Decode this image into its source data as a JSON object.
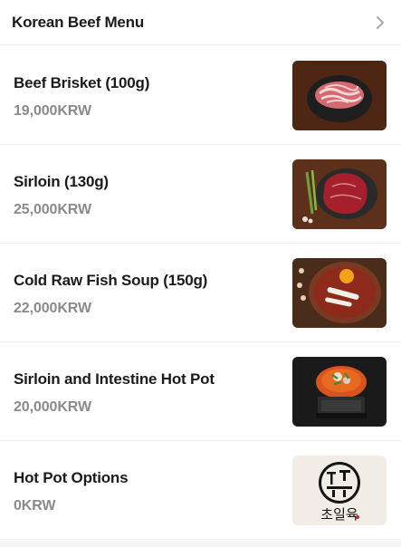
{
  "header": {
    "title": "Korean Beef Menu"
  },
  "items": [
    {
      "name": "Beef Brisket (100g)",
      "price": "19,000KRW",
      "image_icon": "beef-brisket-photo"
    },
    {
      "name": "Sirloin (130g)",
      "price": "25,000KRW",
      "image_icon": "sirloin-photo"
    },
    {
      "name": "Cold Raw Fish Soup (150g)",
      "price": "22,000KRW",
      "image_icon": "raw-beef-dish-photo"
    },
    {
      "name": "Sirloin and Intestine Hot Pot",
      "price": "20,000KRW",
      "image_icon": "hot-pot-photo"
    },
    {
      "name": "Hot Pot Options",
      "price": "0KRW",
      "image_icon": "restaurant-logo"
    }
  ],
  "logo_text": "초일육"
}
